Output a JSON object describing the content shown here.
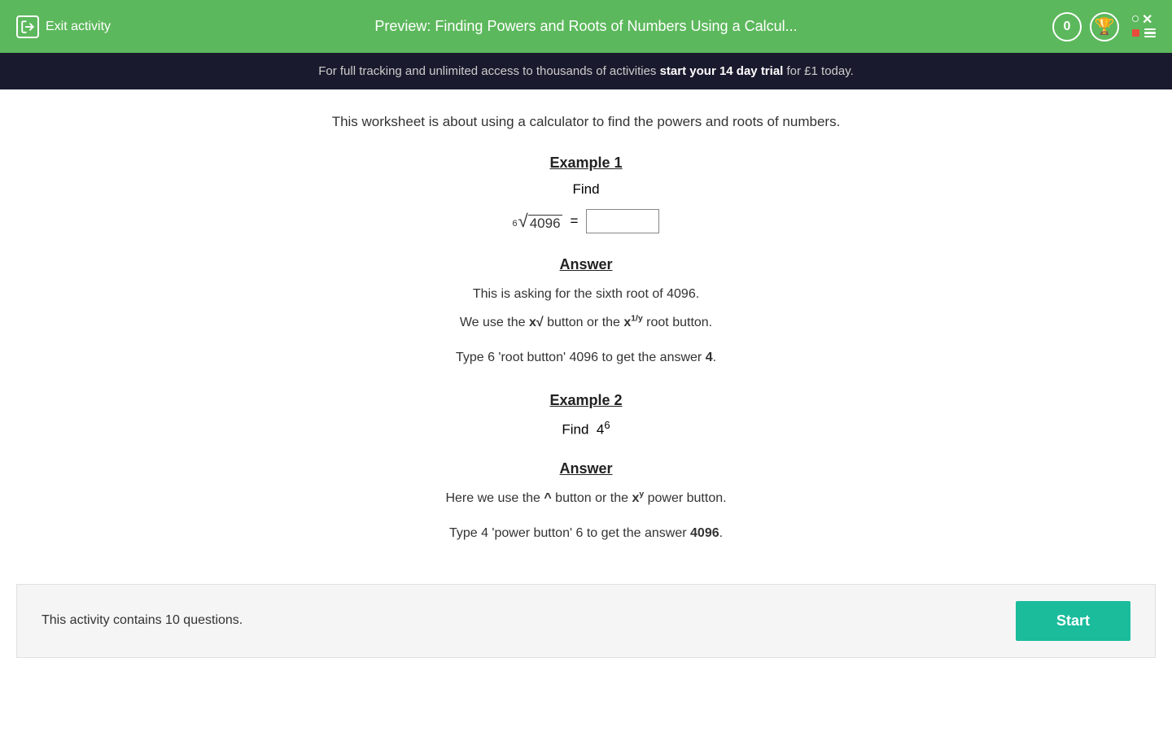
{
  "header": {
    "exit_label": "Exit activity",
    "title": "Preview: Finding Powers and Roots of Numbers Using a Calcul...",
    "score": "0"
  },
  "banner": {
    "text_before": "For full tracking and unlimited access to thousands of activities ",
    "cta_text": "start your 14 day trial",
    "text_after": " for £1 today."
  },
  "main": {
    "intro": "This worksheet is about using a calculator to find the powers and roots of numbers.",
    "example1": {
      "title": "Example 1",
      "find": "Find",
      "math_index": "6",
      "math_radicand": "4096",
      "equals": "=",
      "input_placeholder": ""
    },
    "answer1": {
      "label": "Answer",
      "line1": "This is asking for the sixth root of 4096.",
      "line2_before": "We use the ",
      "line2_xsqrt": "x√",
      "line2_middle": " button or the ",
      "line2_xpow": "x",
      "line2_exp": "1/y",
      "line2_after": " root button.",
      "line3_before": "Type 6 'root button' 4096 to get the answer ",
      "line3_answer": "4",
      "line3_after": "."
    },
    "example2": {
      "title": "Example 2",
      "find": "Find",
      "base": "4",
      "exponent": "6"
    },
    "answer2": {
      "label": "Answer",
      "line1_before": "Here we use the ",
      "line1_caret": "^",
      "line1_middle": " button or the ",
      "line1_xy": "x",
      "line1_y": "y",
      "line1_after": " power button.",
      "line2_before": "Type 4 'power button' 6 to get the answer ",
      "line2_answer": "4096",
      "line2_after": "."
    },
    "bottom": {
      "text": "This activity contains 10 questions.",
      "start_label": "Start"
    }
  }
}
